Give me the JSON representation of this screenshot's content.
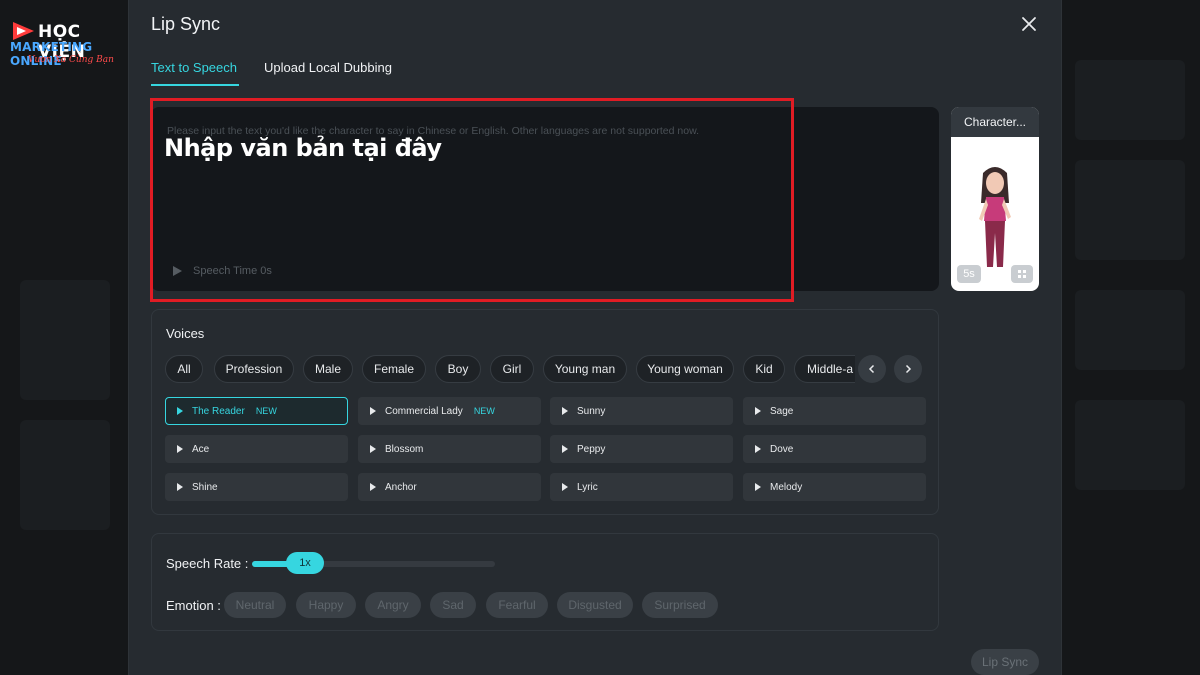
{
  "logo": {
    "line1": "HỌC VIỆN",
    "line2": "MARKETING ONLINE",
    "line3": "Vươn Xa Cùng Bạn"
  },
  "modal": {
    "title": "Lip Sync",
    "tabs": [
      {
        "label": "Text to Speech",
        "active": true
      },
      {
        "label": "Upload Local Dubbing",
        "active": false
      }
    ]
  },
  "text_input": {
    "placeholder": "Please input the text you'd like the character to say in Chinese or English. Other languages are not supported now.",
    "speech_time": "Speech Time 0s",
    "overlay_caption": "Nhập văn bản tại đây"
  },
  "character": {
    "label": "Character...",
    "duration": "5s"
  },
  "voices": {
    "title": "Voices",
    "filters": [
      "All",
      "Profession",
      "Male",
      "Female",
      "Boy",
      "Girl",
      "Young man",
      "Young woman",
      "Kid",
      "Middle-a"
    ],
    "items": [
      {
        "name": "The Reader",
        "tag": "NEW",
        "selected": true
      },
      {
        "name": "Commercial Lady",
        "tag": "NEW",
        "selected": false
      },
      {
        "name": "Sunny",
        "tag": "",
        "selected": false
      },
      {
        "name": "Sage",
        "tag": "",
        "selected": false
      },
      {
        "name": "Ace",
        "tag": "",
        "selected": false
      },
      {
        "name": "Blossom",
        "tag": "",
        "selected": false
      },
      {
        "name": "Peppy",
        "tag": "",
        "selected": false
      },
      {
        "name": "Dove",
        "tag": "",
        "selected": false
      },
      {
        "name": "Shine",
        "tag": "",
        "selected": false
      },
      {
        "name": "Anchor",
        "tag": "",
        "selected": false
      },
      {
        "name": "Lyric",
        "tag": "",
        "selected": false
      },
      {
        "name": "Melody",
        "tag": "",
        "selected": false
      }
    ]
  },
  "settings": {
    "rate_label": "Speech Rate :",
    "rate_value": "1x",
    "rate_fraction": 0.22,
    "emotion_label": "Emotion :",
    "emotions": [
      "Neutral",
      "Happy",
      "Angry",
      "Sad",
      "Fearful",
      "Disgusted",
      "Surprised"
    ]
  },
  "actions": {
    "submit_label": "Lip Sync"
  },
  "colors": {
    "accent": "#36d6e0",
    "highlight_frame": "#e01c24"
  }
}
